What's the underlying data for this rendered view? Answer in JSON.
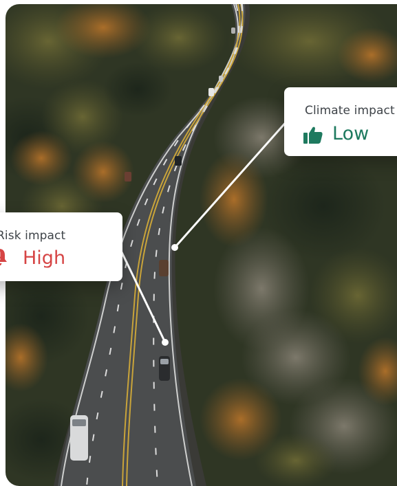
{
  "cards": {
    "climate": {
      "label": "Climate impact",
      "value": "Low",
      "icon": "thumbs-up-icon",
      "color": "#1e7a5f"
    },
    "risk": {
      "label": "Risk impact",
      "value": "High",
      "icon": "alert-bell-icon",
      "color": "#d64545"
    }
  },
  "photo": {
    "subject": "aerial-highway-through-autumn-forest"
  }
}
